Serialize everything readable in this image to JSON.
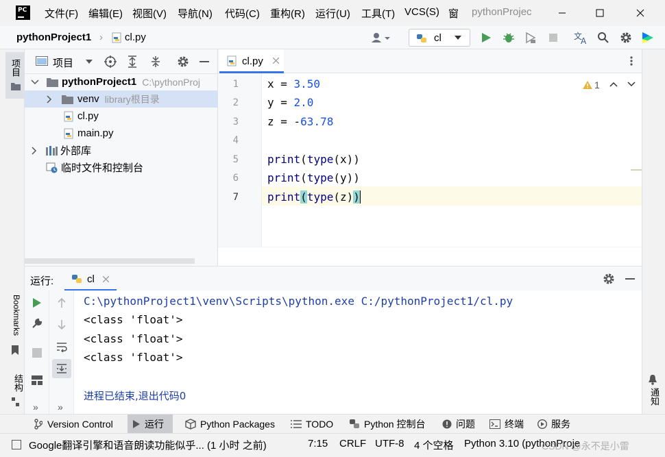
{
  "window": {
    "app_title": "pythonProjec",
    "menu": [
      "文件(F)",
      "编辑(E)",
      "视图(V)",
      "导航(N)",
      "代码(C)",
      "重构(R)",
      "运行(U)",
      "工具(T)",
      "VCS(S)",
      "窗"
    ]
  },
  "nav": {
    "project": "pythonProject1",
    "file": "cl.py",
    "run_config": "cl"
  },
  "project_panel": {
    "title": "项目",
    "tree": [
      {
        "label": "pythonProject1",
        "hint": "C:\\pythonProj"
      },
      {
        "label": "venv",
        "hint": "library根目录"
      },
      {
        "label": "cl.py",
        "hint": ""
      },
      {
        "label": "main.py",
        "hint": ""
      },
      {
        "label": "外部库",
        "hint": ""
      },
      {
        "label": "临时文件和控制台",
        "hint": ""
      }
    ]
  },
  "left_strip": {
    "project_tab": "项目",
    "bookmarks_tab": "Bookmarks",
    "structure_tab": "结构"
  },
  "right_strip": {
    "notifications_tab": "通知"
  },
  "editor": {
    "tab": "cl.py",
    "warning_count": "1",
    "line_numbers": [
      "1",
      "2",
      "3",
      "4",
      "5",
      "6",
      "7"
    ]
  },
  "run_panel": {
    "label": "运行:",
    "tab": "cl",
    "console": [
      "C:\\pythonProject1\\venv\\Scripts\\python.exe C:/pythonProject1/cl.py",
      "<class 'float'>",
      "<class 'float'>",
      "<class 'float'>",
      "",
      "进程已结束,退出代码0"
    ]
  },
  "tool_windows": [
    "Version Control",
    "运行",
    "Python Packages",
    "TODO",
    "Python 控制台",
    "问题",
    "终端",
    "服务"
  ],
  "status": {
    "message": "Google翻译引擎和语音朗读功能似乎... (1 小时 之前)",
    "position": "7:15",
    "line_sep": "CRLF",
    "encoding": "UTF-8",
    "indent": "4 个空格",
    "interpreter": "Python 3.10 (pythonProje",
    "watermark": "CSDN @永不是小雷"
  },
  "colors": {
    "accent_green": "#499c54",
    "number": "#1750eb",
    "keyword": "#000080",
    "selection": "#d5e1f5"
  }
}
